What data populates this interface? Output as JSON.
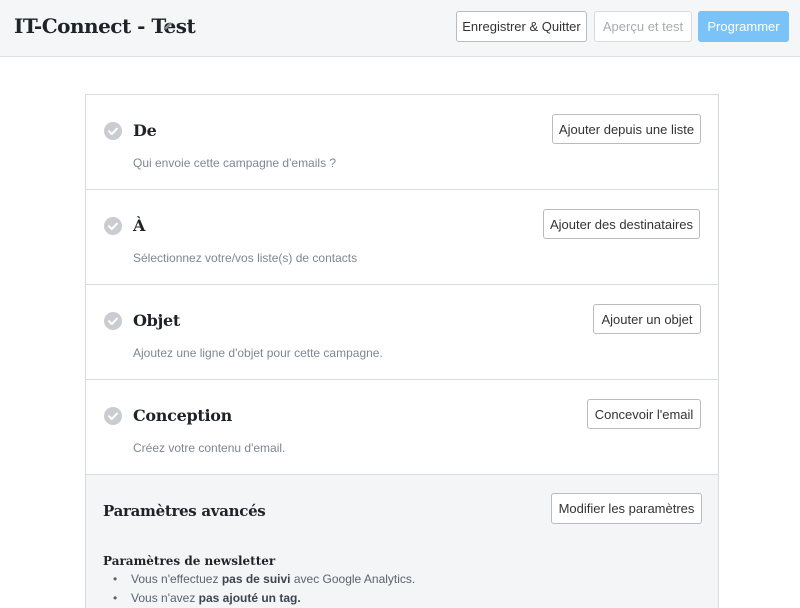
{
  "header": {
    "title": "IT-Connect - Test",
    "edit_icon": "pencil-icon",
    "buttons": {
      "save": "Enregistrer & Quitter",
      "preview": "Aperçu et test",
      "program": "Programmer"
    }
  },
  "sections": [
    {
      "title": "De",
      "description": "Qui envoie cette campagne d'emails ?",
      "button": "Ajouter depuis une liste",
      "icon": "check-circle-icon"
    },
    {
      "title": "À",
      "description": "Sélectionnez votre/vos liste(s) de contacts",
      "button": "Ajouter des destinataires",
      "icon": "check-circle-icon"
    },
    {
      "title": "Objet",
      "description": "Ajoutez une ligne d'objet pour cette campagne.",
      "button": "Ajouter un objet",
      "icon": "check-circle-icon"
    },
    {
      "title": "Conception",
      "description": "Créez votre contenu d'email.",
      "button": "Concevoir l'email",
      "icon": "check-circle-icon"
    }
  ],
  "advanced": {
    "title": "Paramètres avancés",
    "button": "Modifier les paramètres",
    "subtitle": "Paramètres de newsletter",
    "items": [
      {
        "prefix": "Vous n'effectuez ",
        "bold": "pas de suivi",
        "suffix": " avec Google Analytics."
      },
      {
        "prefix": "Vous n'avez ",
        "bold": "pas ajouté un tag.",
        "suffix": ""
      }
    ]
  },
  "colors": {
    "primary_button": "#7ac3f9",
    "check_icon": "#c9ccd1",
    "header_bg": "#f4f6f8",
    "advanced_bg": "#f4f5f6"
  }
}
